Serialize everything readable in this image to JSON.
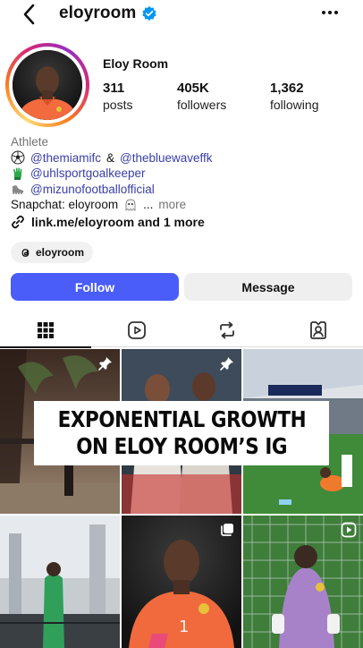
{
  "header": {
    "username": "eloyroom",
    "verified": true,
    "back_icon": "chevron-left-icon",
    "more_icon": "more-horizontal-icon"
  },
  "profile": {
    "display_name": "Eloy Room",
    "stats": {
      "posts": {
        "value": "311",
        "label": "posts"
      },
      "followers": {
        "value": "405K",
        "label": "followers"
      },
      "following": {
        "value": "1,362",
        "label": "following"
      }
    }
  },
  "bio": {
    "category": "Athlete",
    "line1": {
      "mention1": "@themiamifc",
      "connector": "&",
      "mention2": "@thebluewaveffk",
      "icon": "soccer-ball-icon"
    },
    "line2": {
      "mention": "@uhlsportgoalkeeper",
      "icon": "goalkeeper-glove-icon"
    },
    "line3": {
      "mention": "@mizunofootballofficial",
      "icon": "cleat-icon"
    },
    "snapchat": {
      "prefix": "Snapchat: eloyroom",
      "ellipsis": "...",
      "more": "more",
      "icon": "ghost-icon"
    },
    "link": {
      "text": "link.me/eloyroom and 1 more",
      "icon": "link-icon"
    },
    "threads": {
      "label": "eloyroom",
      "icon": "threads-icon"
    }
  },
  "actions": {
    "follow": "Follow",
    "message": "Message"
  },
  "tabs": [
    {
      "name": "posts",
      "icon": "grid-icon",
      "active": true
    },
    {
      "name": "reels",
      "icon": "reels-icon",
      "active": false
    },
    {
      "name": "reposts",
      "icon": "repost-icon",
      "active": false
    },
    {
      "name": "tagged",
      "icon": "tagged-icon",
      "active": false
    }
  ],
  "overlay": {
    "line1": "EXPONENTIAL GROWTH",
    "line2": "ON ELOY ROOM’S IG"
  },
  "grid": [
    {
      "badge": "pin-icon"
    },
    {
      "badge": "pin-icon"
    },
    {
      "badge": ""
    },
    {
      "badge": ""
    },
    {
      "badge": "carousel-icon"
    },
    {
      "badge": "reel-icon"
    }
  ],
  "colors": {
    "follow_button": "#4a5df9",
    "link_text": "#3a3ea8",
    "verified_badge": "#0095f6"
  }
}
